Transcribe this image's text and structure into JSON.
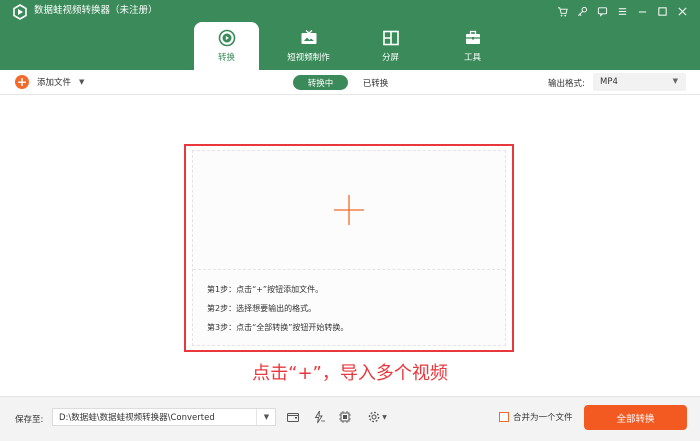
{
  "app": {
    "title": "数据蛙视频转换器（未注册）",
    "icons": [
      "logo-icon"
    ],
    "window_controls": [
      "cart-icon",
      "key-icon",
      "chat-icon",
      "menu-icon",
      "minimize-icon",
      "maximize-icon",
      "close-icon"
    ]
  },
  "tabs": [
    {
      "label": "转换",
      "icon": "convert-icon",
      "active": true
    },
    {
      "label": "短视频制作",
      "icon": "tv-icon",
      "active": false
    },
    {
      "label": "分屏",
      "icon": "split-screen-icon",
      "active": false
    },
    {
      "label": "工具",
      "icon": "toolbox-icon",
      "active": false
    }
  ],
  "toolbar": {
    "add_file_label": "添加文件",
    "status_tabs": [
      "转换中",
      "已转换"
    ],
    "output_format_label": "输出格式:",
    "output_format_value": "MP4"
  },
  "dropzone": {
    "steps": [
      "第1步：点击“+”按钮添加文件。",
      "第2步：选择想要输出的格式。",
      "第3步：点击“全部转换”按钮开始转换。"
    ]
  },
  "callout": "点击“+”，导入多个视频",
  "footer": {
    "save_to_label": "保存至:",
    "save_path": "D:\\数据蛙\\数据蛙视频转换器\\Converted",
    "merge_label": "合并为一个文件",
    "convert_all_label": "全部转换"
  },
  "colors": {
    "brand_green": "#3a8a5a",
    "accent_orange": "#f25a22",
    "highlight_red": "#e8383d"
  }
}
